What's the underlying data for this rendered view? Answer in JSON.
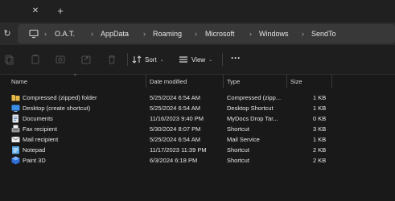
{
  "address": {
    "crumbs": [
      "O.A.T.",
      "AppData",
      "Roaming",
      "Microsoft",
      "Windows",
      "SendTo"
    ]
  },
  "toolbar": {
    "sort_label": "Sort",
    "view_label": "View"
  },
  "columns": {
    "name": "Name",
    "date": "Date modified",
    "type": "Type",
    "size": "Size"
  },
  "files": [
    {
      "icon": "zip-folder-icon",
      "name": "Compressed (zipped) folder",
      "date": "5/25/2024 6:54 AM",
      "type": "Compressed (zipp...",
      "size": "1 KB"
    },
    {
      "icon": "desktop-icon",
      "name": "Desktop (create shortcut)",
      "date": "5/25/2024 6:54 AM",
      "type": "Desktop Shortcut",
      "size": "1 KB"
    },
    {
      "icon": "documents-icon",
      "name": "Documents",
      "date": "11/16/2023 9:40 PM",
      "type": "MyDocs Drop Tar...",
      "size": "0 KB"
    },
    {
      "icon": "fax-icon",
      "name": "Fax recipient",
      "date": "5/30/2024 8:07 PM",
      "type": "Shortcut",
      "size": "3 KB"
    },
    {
      "icon": "mail-icon",
      "name": "Mail recipient",
      "date": "5/25/2024 6:54 AM",
      "type": "Mail Service",
      "size": "1 KB"
    },
    {
      "icon": "notepad-icon",
      "name": "Notepad",
      "date": "11/17/2023 11:39 PM",
      "type": "Shortcut",
      "size": "2 KB"
    },
    {
      "icon": "paint3d-icon",
      "name": "Paint 3D",
      "date": "6/3/2024 6:18 PM",
      "type": "Shortcut",
      "size": "2 KB"
    }
  ]
}
